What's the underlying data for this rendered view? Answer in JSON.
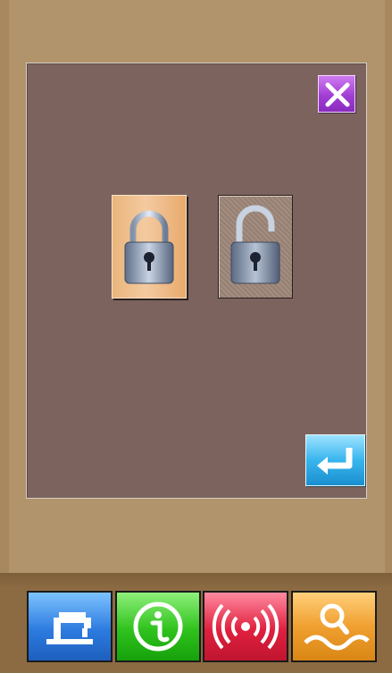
{
  "dialog": {
    "close_icon": "close-x-icon",
    "lock_options": [
      {
        "icon": "padlock-closed-icon",
        "state": "locked",
        "selected": true
      },
      {
        "icon": "padlock-open-icon",
        "state": "unlocked",
        "selected": false
      }
    ],
    "confirm_icon": "enter-return-icon"
  },
  "bottom_nav": [
    {
      "icon": "sewing-machine-icon",
      "color": "#2d7be0"
    },
    {
      "icon": "info-icon",
      "color": "#2fc21c"
    },
    {
      "icon": "signal-waves-icon",
      "color": "#e0203f"
    },
    {
      "icon": "search-pattern-icon",
      "color": "#f0a030"
    }
  ],
  "colors": {
    "background": "#b1946b",
    "dialog": "#7c635e",
    "bottom_bar": "#8c6b43"
  }
}
